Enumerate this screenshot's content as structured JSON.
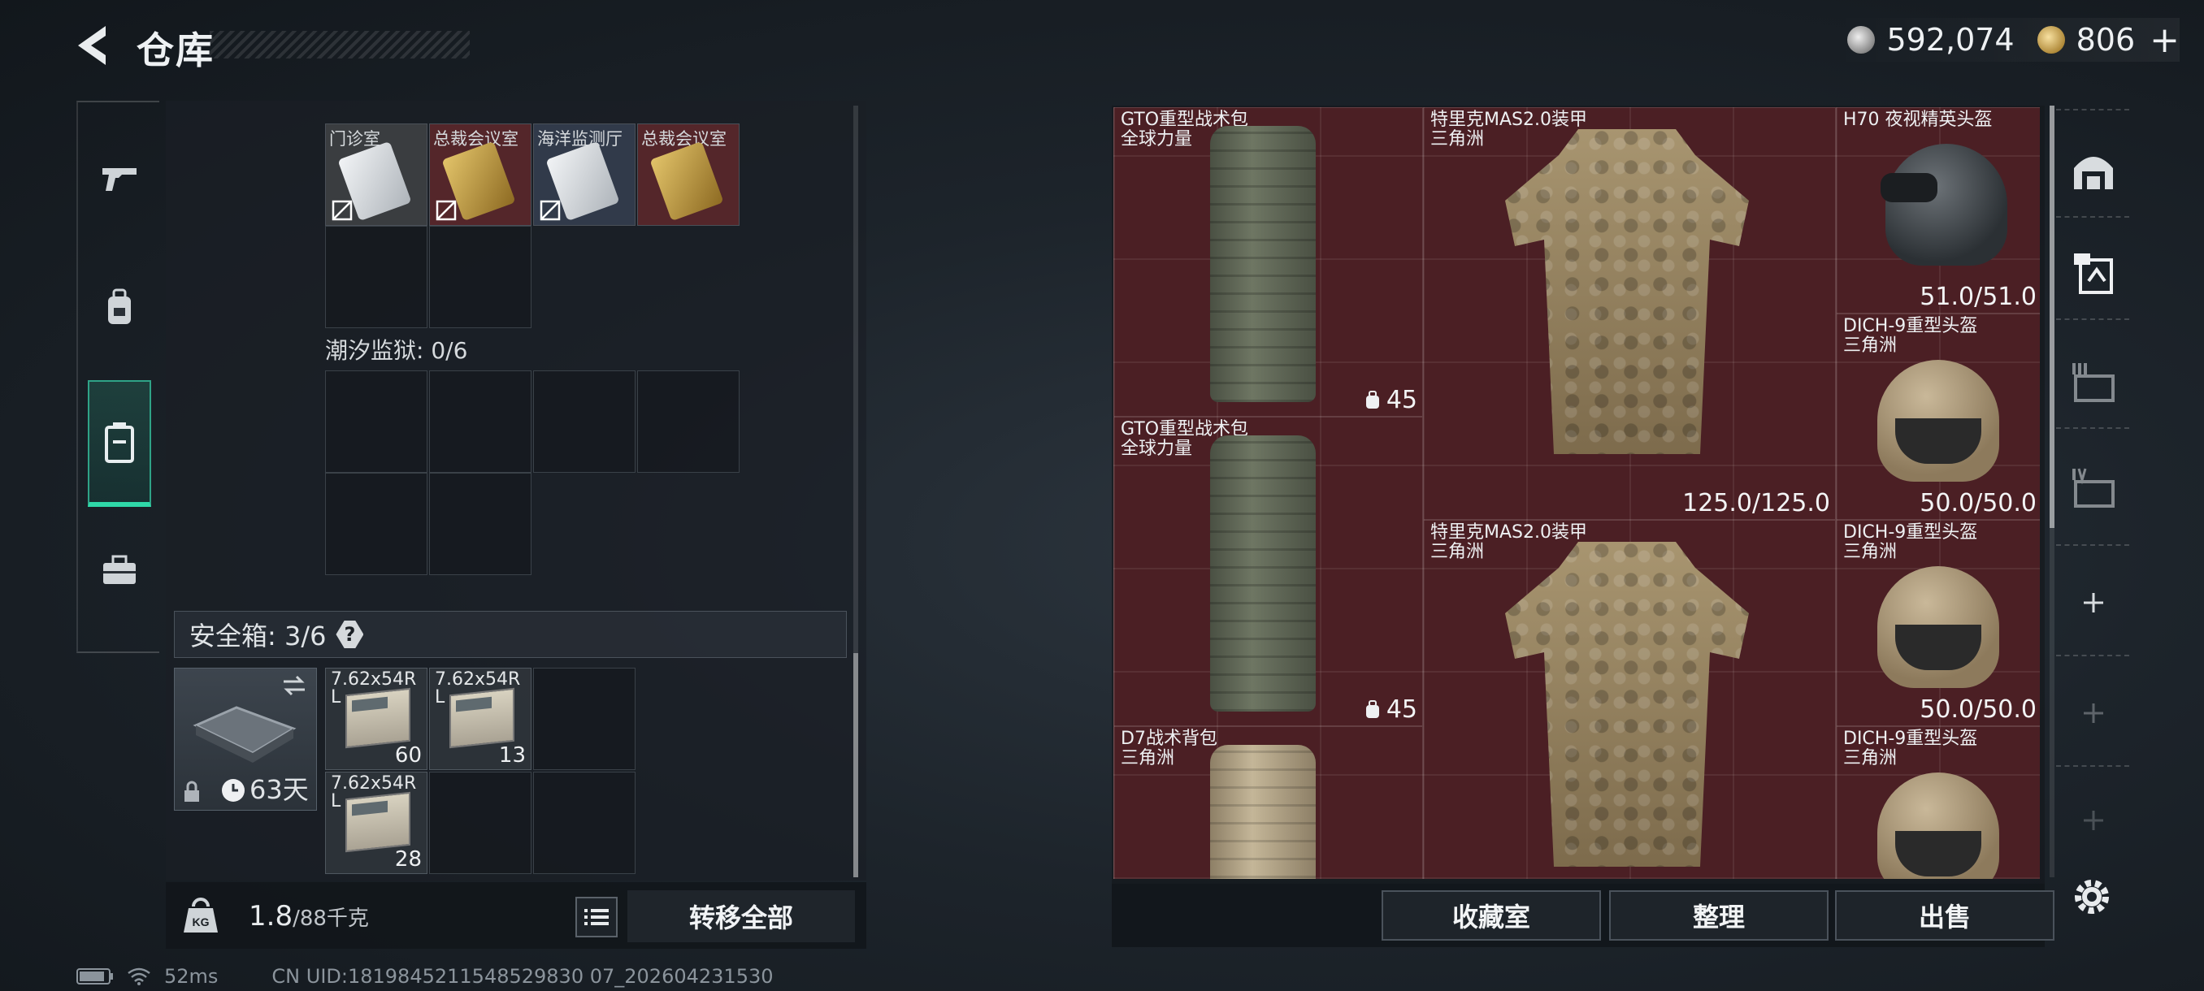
{
  "header": {
    "title": "仓库",
    "currency": {
      "silver": "592,074",
      "gold": "806",
      "add_label": "+"
    }
  },
  "left_panel": {
    "top_items": [
      {
        "label": "门诊室",
        "color": "#cfd6dc"
      },
      {
        "label": "总裁会议室",
        "color": "#c9a64a"
      },
      {
        "label": "海洋监测厅",
        "color": "#cfd6dc"
      },
      {
        "label": "总裁会议室",
        "color": "#c9a64a"
      }
    ],
    "section_label": "潮汐监狱: 0/6",
    "safe_title": "安全箱: 3/6",
    "safe_help": "?",
    "safe_timer": "63天",
    "ammo": [
      {
        "name": "7.62x54R",
        "sub": "L",
        "qty": "60"
      },
      {
        "name": "7.62x54R",
        "sub": "L",
        "qty": "13"
      },
      {
        "name": "7.62x54R",
        "sub": "L",
        "qty": "28"
      }
    ],
    "weight_value": "1.8",
    "weight_unit": "/88千克",
    "transfer_all": "转移全部"
  },
  "storage": {
    "items": [
      {
        "name": "GTO重型战术包",
        "sub": "全球力量",
        "count": "45"
      },
      {
        "name": "特里克MAS2.0装甲",
        "sub": "三角洲",
        "durability": "125.0/125.0"
      },
      {
        "name": "H70 夜视精英头盔",
        "sub": "",
        "durability": "51.0/51.0"
      },
      {
        "name": "DICH-9重型头盔",
        "sub": "三角洲",
        "durability": "50.0/50.0"
      },
      {
        "name": "GTO重型战术包",
        "sub": "全球力量",
        "count": "45"
      },
      {
        "name": "特里克MAS2.0装甲",
        "sub": "三角洲",
        "durability": ""
      },
      {
        "name": "DICH-9重型头盔",
        "sub": "三角洲",
        "durability": "50.0/50.0"
      },
      {
        "name": "D7战术背包",
        "sub": "三角洲"
      },
      {
        "name": "DICH-9重型头盔",
        "sub": "三角洲"
      }
    ]
  },
  "actions": {
    "collection": "收藏室",
    "organize": "整理",
    "sell": "出售"
  },
  "status": {
    "ping": "52ms",
    "uid": "CN UID:1819845211548529830 07_202604231530"
  }
}
